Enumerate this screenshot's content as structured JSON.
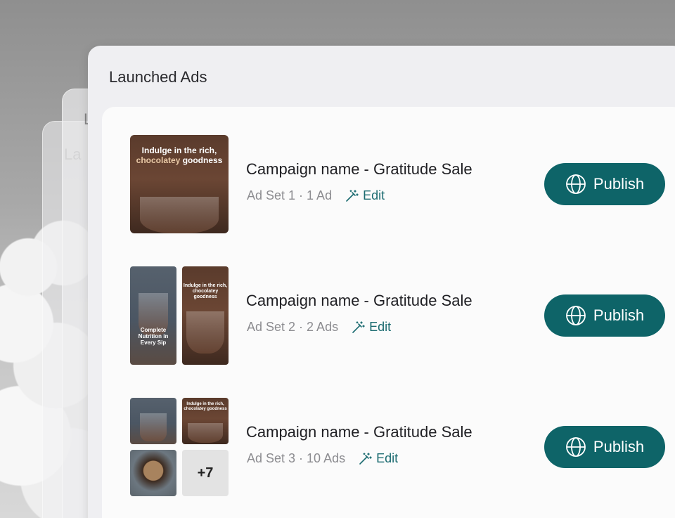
{
  "ghost_labels": [
    "La",
    "L"
  ],
  "panel": {
    "title": "Launched Ads"
  },
  "rows": [
    {
      "title": "Campaign name - Gratitude Sale",
      "meta": "Ad Set 1 · 1 Ad",
      "edit_label": "Edit",
      "publish_label": "Publish",
      "thumb_text_1": "Indulge in the rich,",
      "thumb_text_2": "chocolatey",
      "thumb_text_3": "goodness"
    },
    {
      "title": "Campaign name - Gratitude Sale",
      "meta": "Ad Set 2 · 2 Ads",
      "edit_label": "Edit",
      "publish_label": "Publish",
      "thumb_a_text": "Complete Nutrition in Every Sip",
      "thumb_b_text": "Indulge in the rich, chocolatey goodness"
    },
    {
      "title": "Campaign name - Gratitude Sale",
      "meta": "Ad Set 3 · 10 Ads",
      "edit_label": "Edit",
      "publish_label": "Publish",
      "thumb_b_text": "Indulge in the rich, chocolatey goodness",
      "more_count": "+7"
    }
  ],
  "colors": {
    "accent": "#0e6468",
    "edit": "#1b6b70"
  },
  "icons": {
    "edit": "magic-wand-icon",
    "publish": "globe-icon"
  }
}
